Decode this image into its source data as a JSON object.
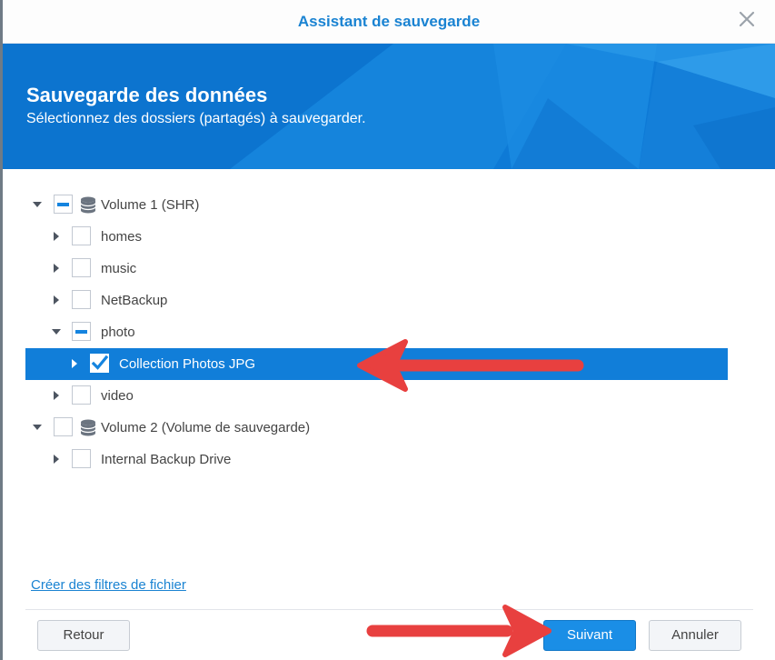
{
  "window": {
    "title": "Assistant de sauvegarde"
  },
  "banner": {
    "heading": "Sauvegarde des données",
    "subheading": "Sélectionnez des dossiers (partagés) à sauvegarder."
  },
  "tree": {
    "volume1": {
      "label": "Volume 1 (SHR)",
      "state": "partial",
      "expanded": true
    },
    "homes": {
      "label": "homes",
      "state": "unchecked"
    },
    "music": {
      "label": "music",
      "state": "unchecked"
    },
    "netbackup": {
      "label": "NetBackup",
      "state": "unchecked"
    },
    "photo": {
      "label": "photo",
      "state": "partial",
      "expanded": true
    },
    "collection": {
      "label": "Collection Photos JPG",
      "state": "checked",
      "selected": true
    },
    "video": {
      "label": "video",
      "state": "unchecked"
    },
    "volume2": {
      "label": "Volume 2 (Volume de sauvegarde)",
      "state": "unchecked",
      "expanded": true
    },
    "internal": {
      "label": "Internal Backup Drive",
      "state": "unchecked"
    }
  },
  "filters_link": "Créer des filtres de fichier",
  "footer": {
    "back": "Retour",
    "next": "Suivant",
    "cancel": "Annuler"
  },
  "icons": [
    "close-icon",
    "database-icon",
    "caret-right-icon",
    "caret-down-icon",
    "checkmark-icon"
  ],
  "colors": {
    "accent": "#1a83d2",
    "selection": "#117ed9",
    "annotation_arrow": "#e8403f"
  }
}
